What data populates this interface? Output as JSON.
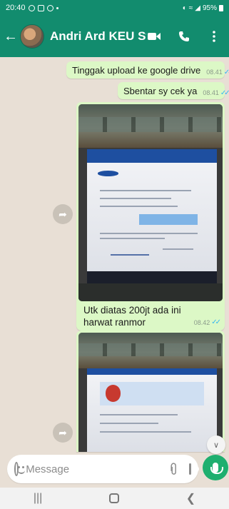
{
  "status_bar": {
    "time": "20:40",
    "battery": "95%"
  },
  "header": {
    "contact_name": "Andri Ard KEU Staf..."
  },
  "messages": [
    {
      "text": "Tinggak upload ke google drive",
      "time": "08.41"
    },
    {
      "text": "Sbentar sy cek ya",
      "time": "08.41"
    },
    {
      "caption": "Utk diatas 200jt ada ini harwat ranmor",
      "time": "08.42"
    }
  ],
  "input": {
    "placeholder": "Message"
  },
  "colors": {
    "header": "#128c6e",
    "bubble": "#dcf8c6",
    "chat_bg": "#e8dfd5",
    "mic": "#1eaf6f",
    "ticks": "#34b7f1"
  },
  "icons": {
    "back": "arrow-left-icon",
    "video": "video-call-icon",
    "call": "phone-icon",
    "menu": "more-vert-icon",
    "forward": "forward-icon",
    "scroll": "double-chevron-down-icon",
    "emoji": "emoji-icon",
    "attach": "paperclip-icon",
    "camera": "camera-icon",
    "mic": "mic-icon"
  }
}
